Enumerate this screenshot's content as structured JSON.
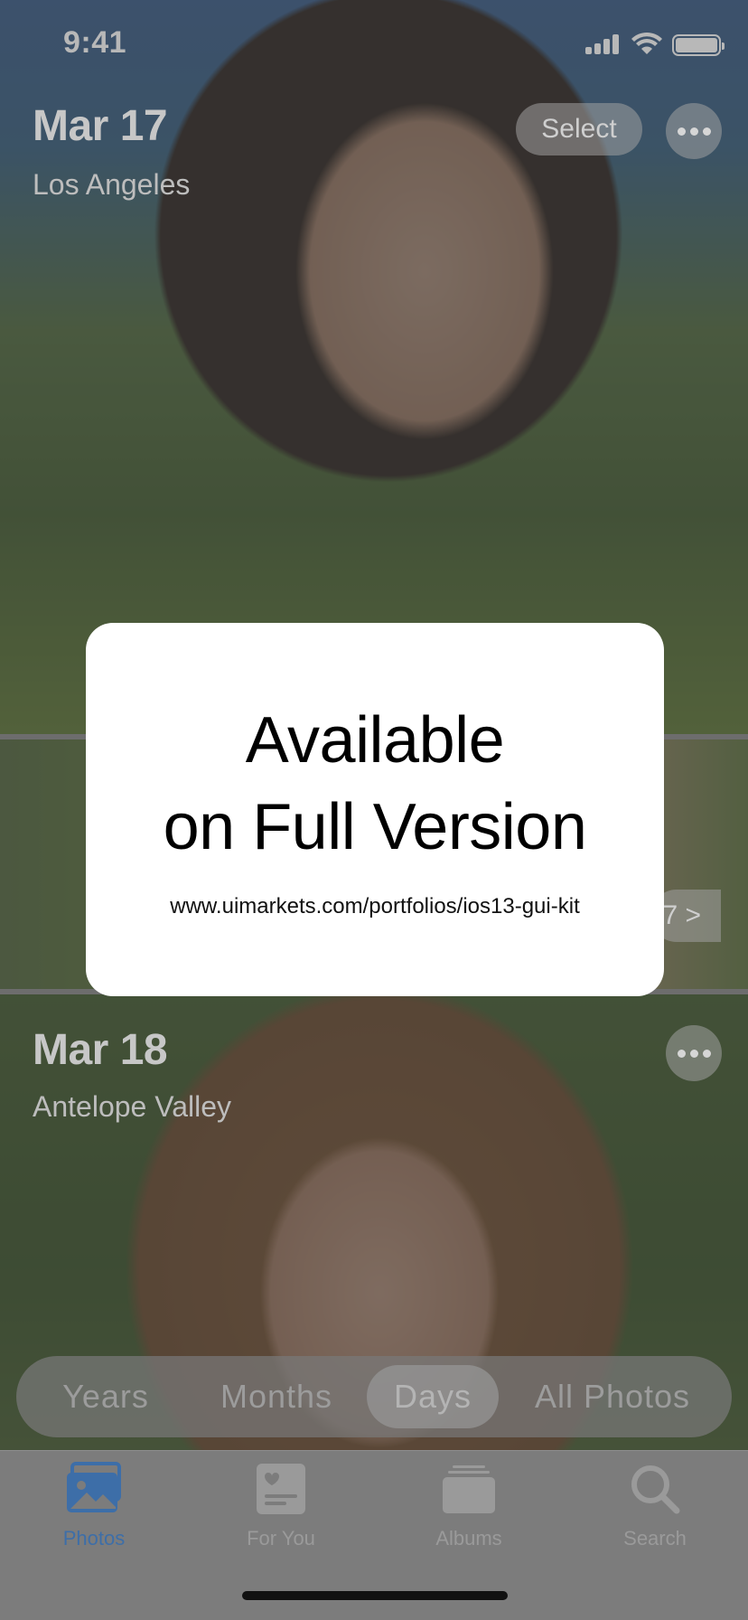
{
  "status_bar": {
    "time": "9:41"
  },
  "sections": [
    {
      "date": "Mar 17",
      "place": "Los Angeles",
      "select_label": "Select"
    },
    {
      "count_label": "7 >"
    },
    {
      "date": "Mar 18",
      "place": "Antelope Valley"
    }
  ],
  "segmented_control": {
    "items": [
      "Years",
      "Months",
      "Days",
      "All Photos"
    ],
    "selected": "Days"
  },
  "tab_bar": {
    "items": [
      {
        "label": "Photos",
        "icon": "photos-icon",
        "active": true
      },
      {
        "label": "For You",
        "icon": "for-you-icon",
        "active": false
      },
      {
        "label": "Albums",
        "icon": "albums-icon",
        "active": false
      },
      {
        "label": "Search",
        "icon": "search-icon",
        "active": false
      }
    ]
  },
  "modal": {
    "title_line1": "Available",
    "title_line2": "on Full Version",
    "url": "www.uimarkets.com/portfolios/ios13-gui-kit"
  },
  "colors": {
    "accent": "#3d6ea8",
    "overlay": "#5a5a5a"
  }
}
